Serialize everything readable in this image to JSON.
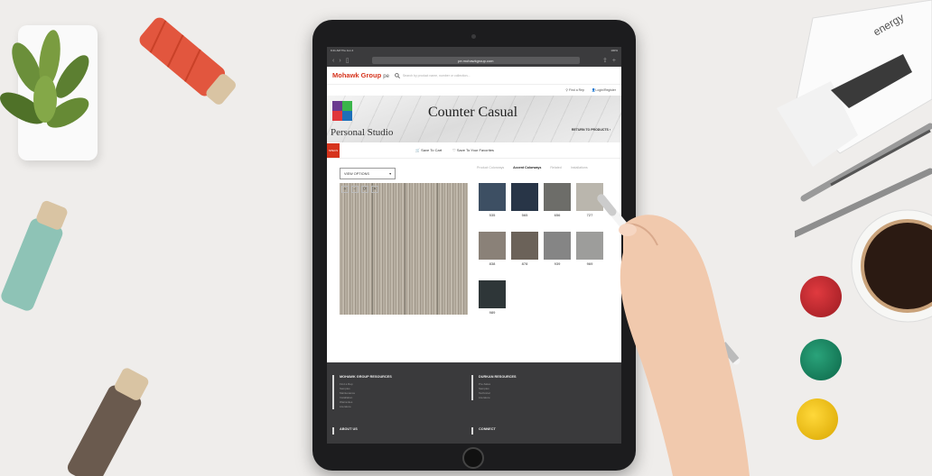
{
  "browser": {
    "status_left": "9:41 AM  Thu Jun 4",
    "status_right": "100%",
    "tab_label": "AA",
    "url": "pe.mohawkgroup.com"
  },
  "site": {
    "brand": "Mohawk Group",
    "brand_suffix": "pe",
    "search_placeholder": "Search by product name, number or collection...",
    "find_rep": "Find a Rep",
    "login": "Login/Register"
  },
  "hero": {
    "studio_name": "Personal Studio",
    "title": "Counter Casual",
    "return_link": "RETURN TO PRODUCTS ›"
  },
  "actions": {
    "specs_tab": "SPECS",
    "save_to_cart": "Save To Cart",
    "save_to_favorites": "Save To Your Favorites"
  },
  "viewer": {
    "view_options": "VIEW OPTIONS",
    "tools": [
      "+",
      "−",
      "⟳",
      "✕"
    ]
  },
  "colorway_tabs": [
    "Product Colorways",
    "Accent Colorways",
    "Related",
    "Installations"
  ],
  "swatches": [
    {
      "code": "535",
      "color": "#3d4f63"
    },
    {
      "code": "565",
      "color": "#283547"
    },
    {
      "code": "656",
      "color": "#6d6d69"
    },
    {
      "code": "727",
      "color": "#bab6ad"
    },
    {
      "code": "838",
      "color": "#8a8178"
    },
    {
      "code": "878",
      "color": "#6b6259"
    },
    {
      "code": "939",
      "color": "#858585"
    },
    {
      "code": "969",
      "color": "#9d9d9b"
    },
    {
      "code": "989",
      "color": "#2e3638"
    }
  ],
  "footer": {
    "col1_title": "MOHAWK GROUP RESOURCES",
    "col1_items": [
      "Find a Rep",
      "Samples",
      "Maintenance",
      "Installation",
      "Warranties",
      "Literature"
    ],
    "col2_title": "DURKAN RESOURCES",
    "col2_items": [
      "Pre-Sales",
      "Samples",
      "Technical",
      "Literature"
    ],
    "about": "ABOUT US",
    "connect": "CONNECT"
  },
  "colors": {
    "desk": "#efedeb",
    "brand_red": "#d6331c",
    "tablet_bezel": "#1c1c1e",
    "footer": "#3a3a3c"
  },
  "icons": [
    "succulent-plant",
    "red-thread-spool",
    "teal-thread-spool",
    "brown-thread-spool",
    "blueprint-roll",
    "mechanical-pencil",
    "coffee-cup",
    "pompom-red",
    "pompom-green",
    "pompom-yellow",
    "stylus-pencil",
    "hand"
  ]
}
